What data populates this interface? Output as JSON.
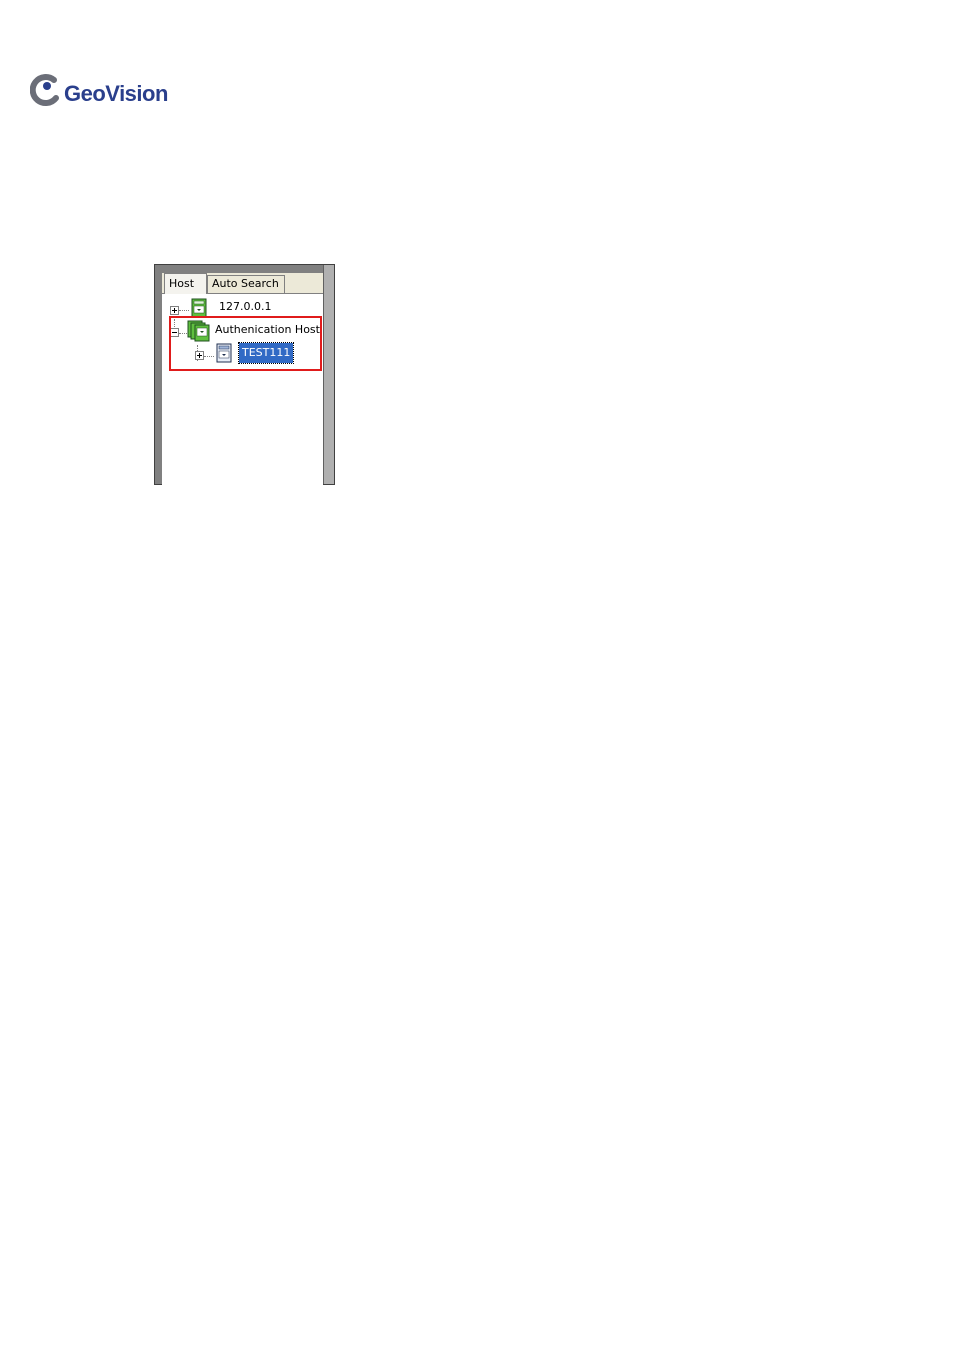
{
  "logo": {
    "brand": "GeoVision",
    "mark_icon": "geovision-logo-icon",
    "brand_color": "#2a3f8c"
  },
  "panel": {
    "tabs": [
      {
        "label": "Host",
        "active": true
      },
      {
        "label": "Auto Search",
        "active": false
      }
    ],
    "tree": [
      {
        "label": "127.0.0.1",
        "expanded": false,
        "icon": "server-icon",
        "level": 0
      },
      {
        "label": "Authenication Host",
        "expanded": true,
        "icon": "server-group-icon",
        "level": 0
      },
      {
        "label": "TEST111",
        "expanded": false,
        "icon": "host-computer-icon",
        "level": 1,
        "selected": true
      }
    ],
    "colors": {
      "selection": "#316ac5",
      "highlight_box": "#e01b1b",
      "server_icon": "#5fbf3f"
    }
  }
}
